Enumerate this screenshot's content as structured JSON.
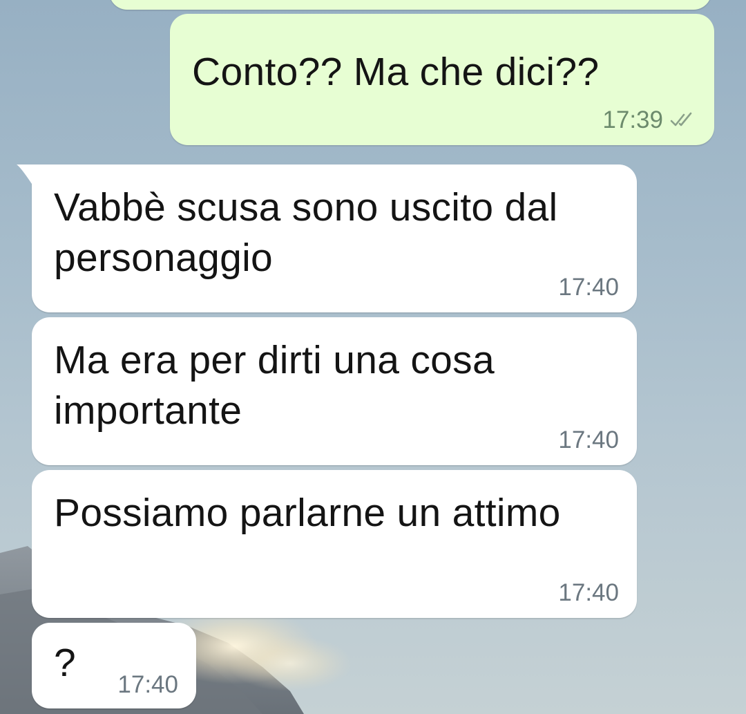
{
  "wallpaper": {
    "description_icon": "mountain-landscape"
  },
  "messages": [
    {
      "direction": "out",
      "text": "Conto?? Ma che dici??",
      "time": "17:39",
      "status": "read-double-check-icon"
    },
    {
      "direction": "in",
      "text": "Vabbè scusa sono uscito dal personaggio",
      "time": "17:40"
    },
    {
      "direction": "in",
      "text": "Ma era per dirti una cosa importante",
      "time": "17:40"
    },
    {
      "direction": "in",
      "text": "Possiamo parlarne un attimo",
      "time": "17:40"
    },
    {
      "direction": "in",
      "text": "?",
      "time": "17:40"
    }
  ],
  "colors": {
    "outgoing_bubble": "#e7fed3",
    "incoming_bubble": "#ffffff",
    "meta_text": "#6b7780",
    "check_mark": "#8aa08a"
  }
}
